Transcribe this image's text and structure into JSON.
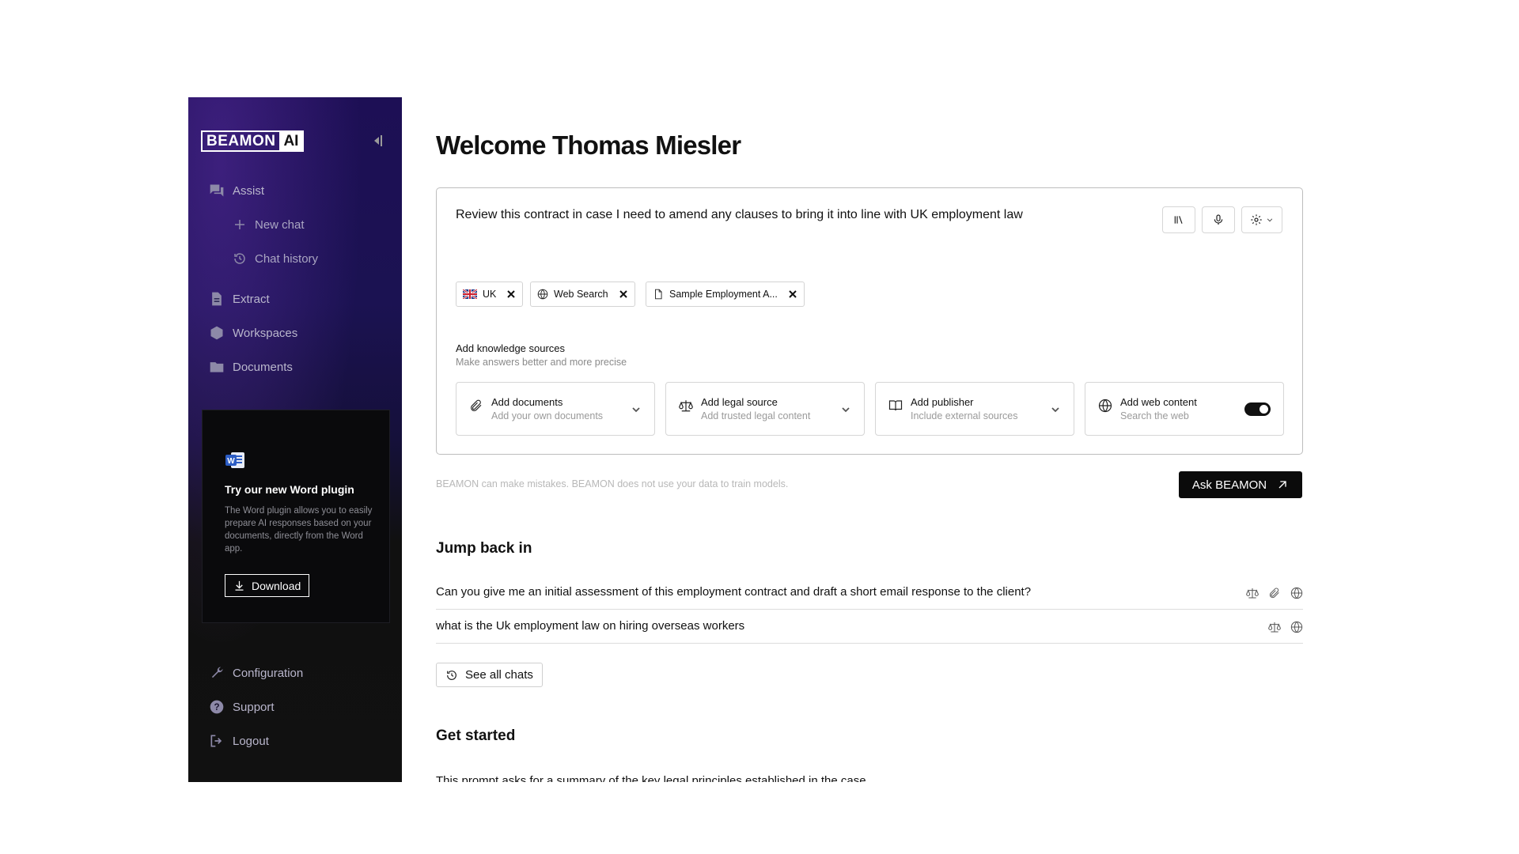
{
  "sidebar": {
    "logo": {
      "part1": "BEAMON",
      "part2": "AI"
    },
    "nav": {
      "assist": "Assist",
      "new_chat": "New chat",
      "chat_history": "Chat history",
      "extract": "Extract",
      "workspaces": "Workspaces",
      "documents": "Documents"
    },
    "promo": {
      "title": "Try our new Word plugin",
      "text": "The Word plugin allows you to easily prepare AI responses based on your documents, directly from the Word app.",
      "button": "Download"
    },
    "bottom": {
      "configuration": "Configuration",
      "support": "Support",
      "logout": "Logout"
    }
  },
  "main": {
    "welcome": "Welcome Thomas Miesler",
    "prompt": "Review this contract in case I need to amend any clauses to bring it into line with UK employment law",
    "chips": [
      {
        "label": "UK",
        "icon": "uk-flag-icon"
      },
      {
        "label": "Web Search",
        "icon": "globe-icon"
      },
      {
        "label": "Sample Employment A...",
        "icon": "file-icon"
      }
    ],
    "knowledge": {
      "title": "Add knowledge sources",
      "subtitle": "Make answers better and more precise",
      "sources": [
        {
          "title": "Add documents",
          "subtitle": "Add your own documents",
          "icon": "paperclip-icon"
        },
        {
          "title": "Add legal source",
          "subtitle": "Add trusted legal content",
          "icon": "scales-icon"
        },
        {
          "title": "Add publisher",
          "subtitle": "Include external sources",
          "icon": "book-icon"
        },
        {
          "title": "Add web content",
          "subtitle": "Search the web",
          "icon": "globe-icon",
          "toggle_on": true
        }
      ]
    },
    "disclaimer": "BEAMON can make mistakes. BEAMON does not use your data to train models.",
    "ask_button": "Ask BEAMON",
    "jump_back_title": "Jump back in",
    "chats": [
      {
        "text": "Can you give me an initial assessment of this employment contract and draft a short email response to the client?",
        "icons": [
          "scales-icon",
          "paperclip-icon",
          "globe-icon"
        ]
      },
      {
        "text": "what is the Uk employment law on hiring overseas workers",
        "icons": [
          "scales-icon",
          "globe-icon"
        ]
      }
    ],
    "see_all": "See all chats",
    "get_started_title": "Get started",
    "starter_prompt": "This prompt asks for a summary of the key legal principles established in the case."
  }
}
